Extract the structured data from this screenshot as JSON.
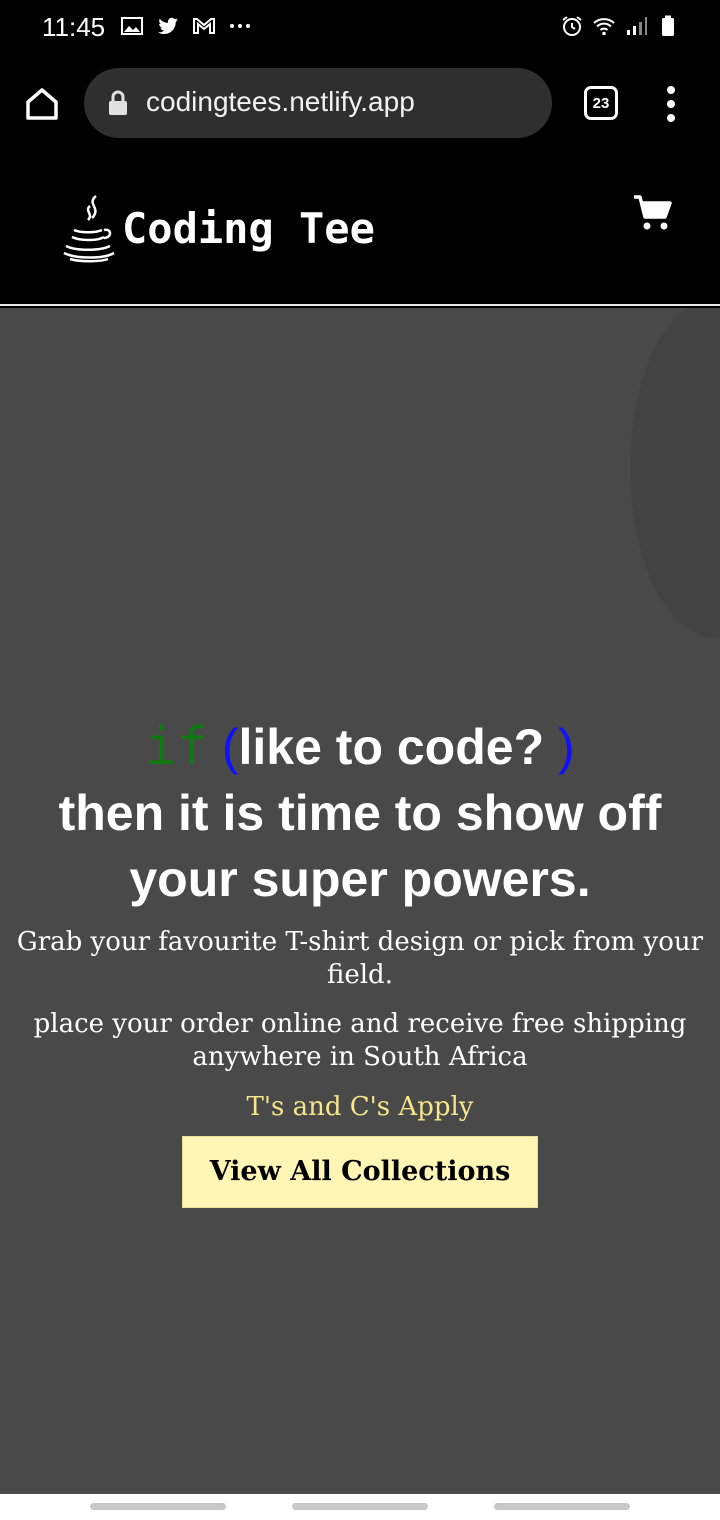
{
  "status_bar": {
    "time": "11:45",
    "left_icons": [
      "gallery-icon",
      "twitter-icon",
      "gmail-icon",
      "more-dots-icon"
    ],
    "right_icons": [
      "alarm-icon",
      "wifi-icon",
      "signal-icon",
      "battery-icon"
    ]
  },
  "browser": {
    "url": "codingtees.netlify.app",
    "tab_count": "23"
  },
  "site": {
    "brand_name": "Coding Tee"
  },
  "hero": {
    "keyword": "if",
    "paren_open": "(",
    "question": "like to code? ",
    "paren_close": ")",
    "headline_rest": "then it is time to show off your super powers.",
    "paragraph1": "Grab your favourite T-shirt design or pick from your field.",
    "paragraph2": "place your order online and receive free shipping anywhere in South Africa",
    "terms": "T's and C's Apply",
    "cta_label": "View All Collections"
  },
  "colors": {
    "hero_background": "#494949",
    "keyword_green": "#0f7a0f",
    "paren_blue": "#1010ff",
    "terms_yellow": "#f7e58a",
    "cta_background": "#fff5b4"
  }
}
